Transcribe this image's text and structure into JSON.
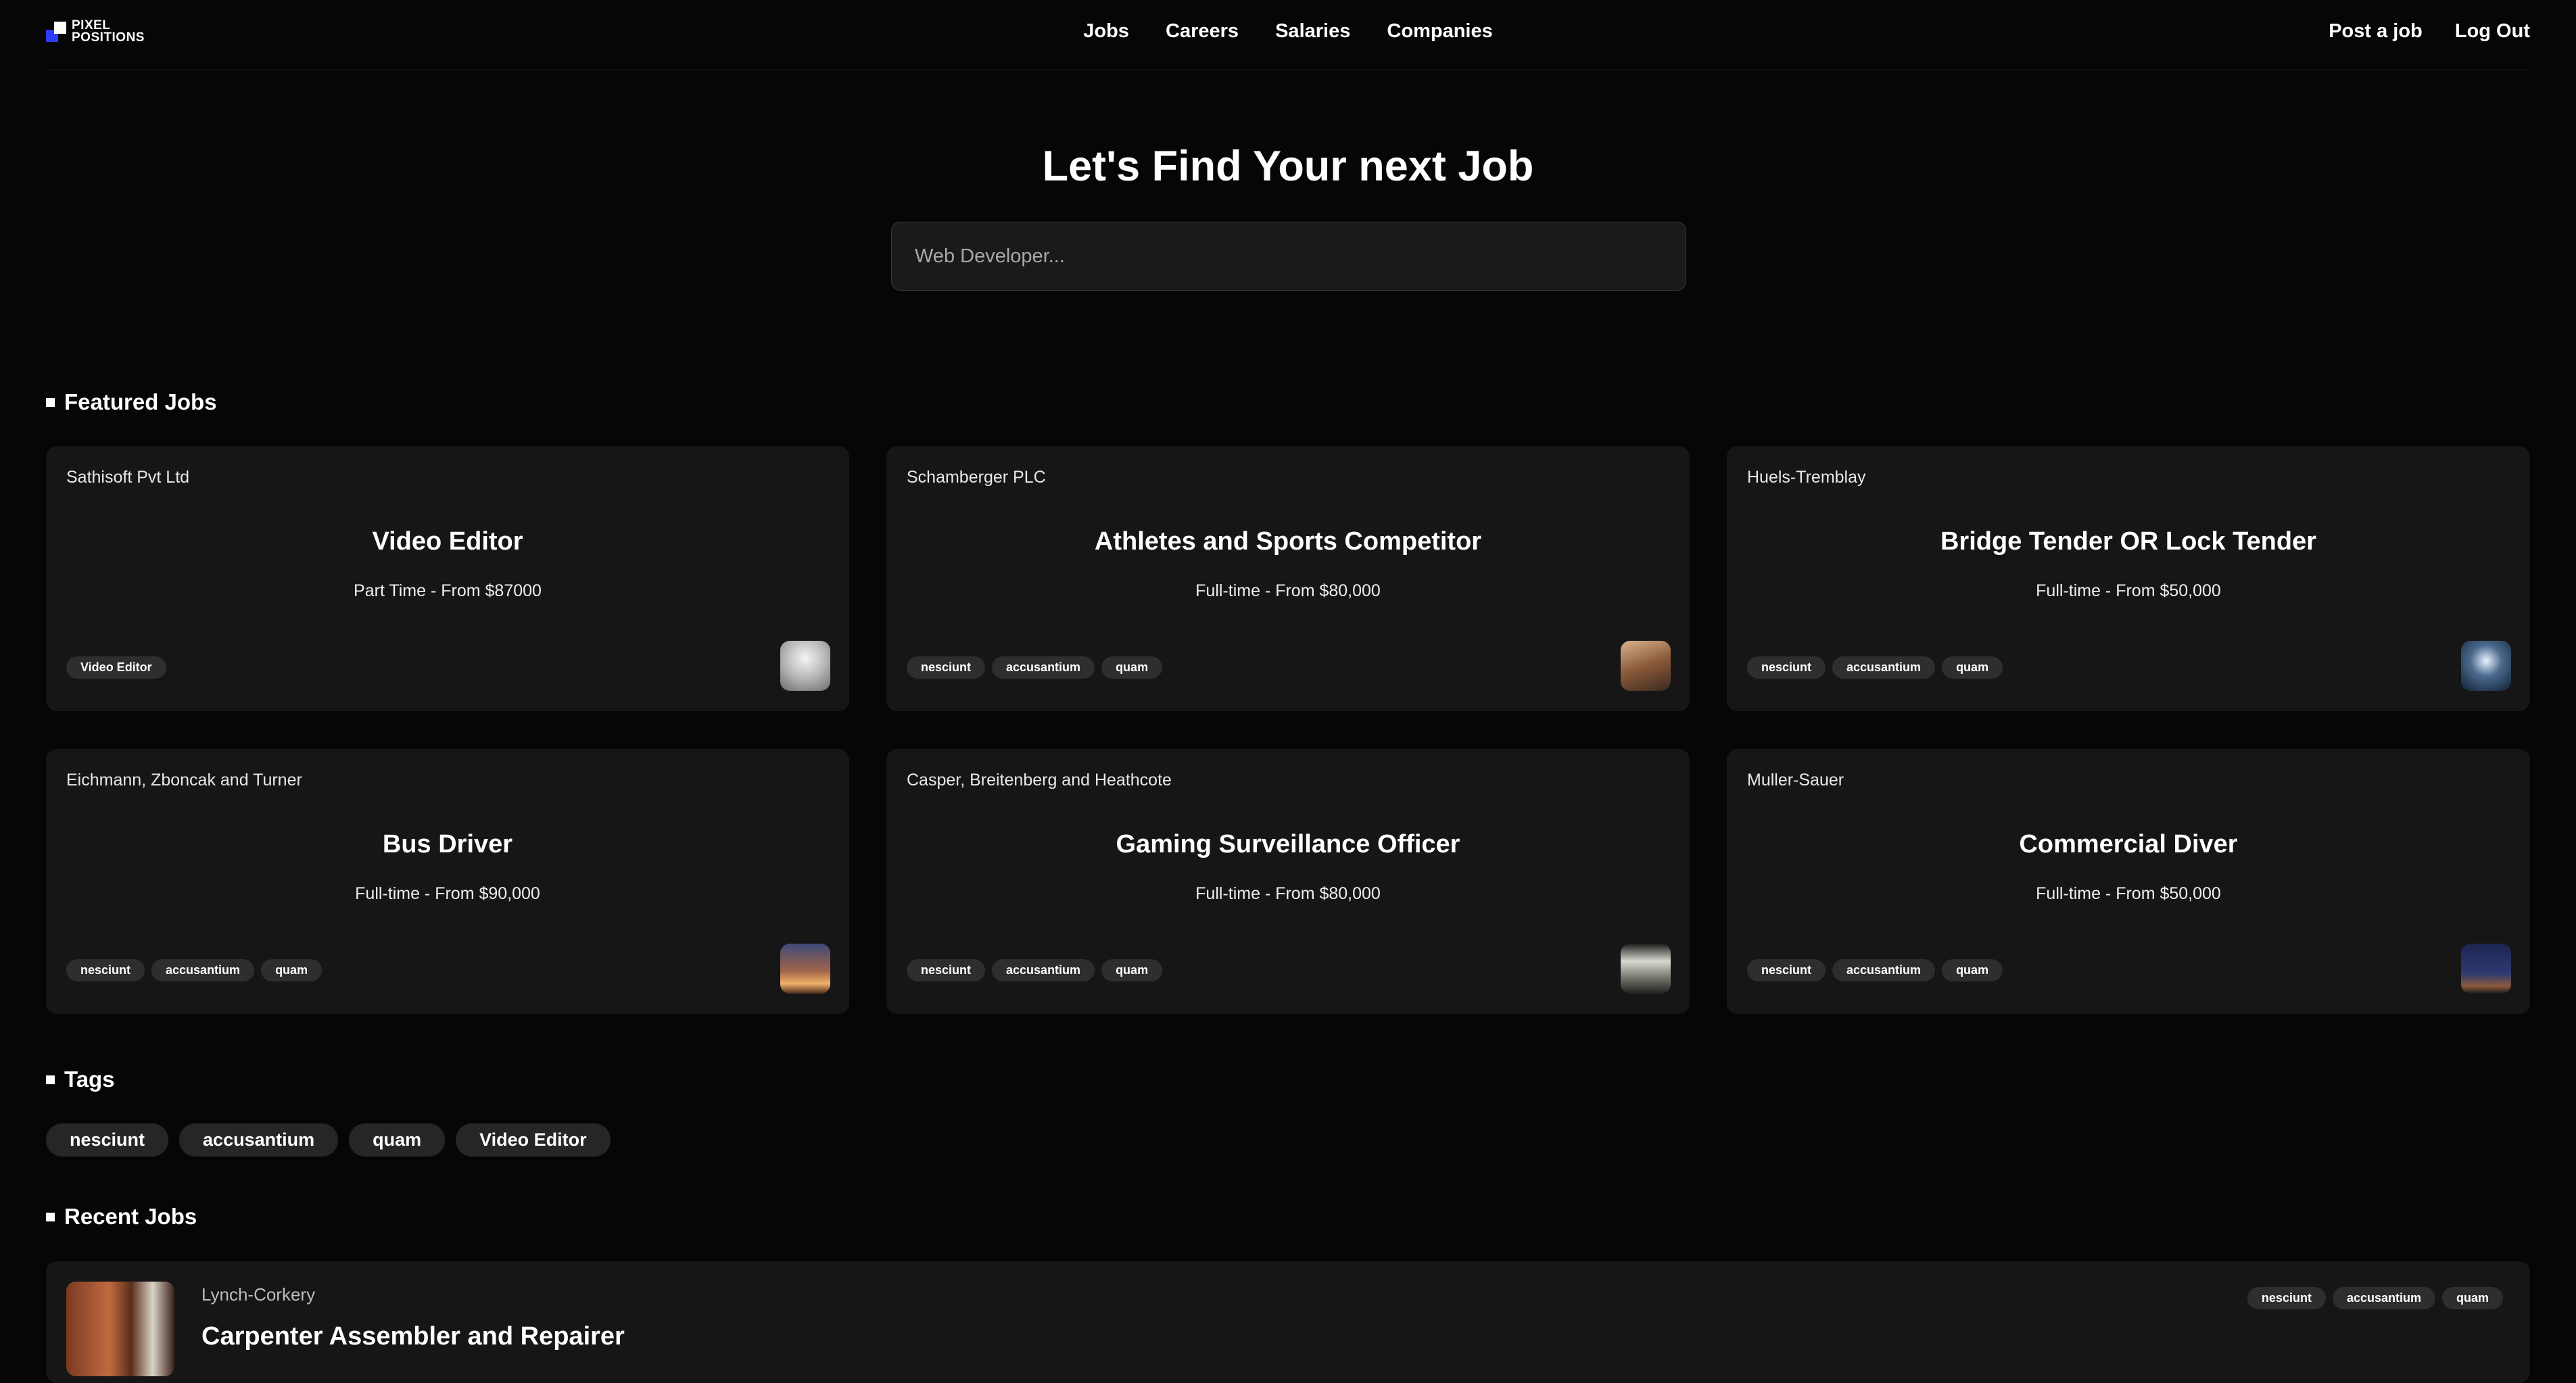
{
  "brand": {
    "logo_line1": "PIXEL",
    "logo_line2": "POSITIONS"
  },
  "nav": [
    "Jobs",
    "Careers",
    "Salaries",
    "Companies"
  ],
  "header_actions": {
    "post_job": "Post a job",
    "logout": "Log Out"
  },
  "hero": {
    "title": "Let's Find Your next Job",
    "search_placeholder": "Web Developer..."
  },
  "featured": {
    "heading": "Featured Jobs",
    "cards": [
      {
        "company": "Sathisoft Pvt Ltd",
        "title": "Video Editor",
        "meta": "Part Time - From $87000",
        "tags": [
          "Video Editor"
        ]
      },
      {
        "company": "Schamberger PLC",
        "title": "Athletes and Sports Competitor",
        "meta": "Full-time - From $80,000",
        "tags": [
          "nesciunt",
          "accusantium",
          "quam"
        ]
      },
      {
        "company": "Huels-Tremblay",
        "title": "Bridge Tender OR Lock Tender",
        "meta": "Full-time - From $50,000",
        "tags": [
          "nesciunt",
          "accusantium",
          "quam"
        ]
      },
      {
        "company": "Eichmann, Zboncak and Turner",
        "title": "Bus Driver",
        "meta": "Full-time - From $90,000",
        "tags": [
          "nesciunt",
          "accusantium",
          "quam"
        ]
      },
      {
        "company": "Casper, Breitenberg and Heathcote",
        "title": "Gaming Surveillance Officer",
        "meta": "Full-time - From $80,000",
        "tags": [
          "nesciunt",
          "accusantium",
          "quam"
        ]
      },
      {
        "company": "Muller-Sauer",
        "title": "Commercial Diver",
        "meta": "Full-time - From $50,000",
        "tags": [
          "nesciunt",
          "accusantium",
          "quam"
        ]
      }
    ]
  },
  "tags_section": {
    "heading": "Tags",
    "tags": [
      "nesciunt",
      "accusantium",
      "quam",
      "Video Editor"
    ]
  },
  "recent": {
    "heading": "Recent Jobs",
    "jobs": [
      {
        "company": "Lynch-Corkery",
        "title": "Carpenter Assembler and Repairer",
        "tags": [
          "nesciunt",
          "accusantium",
          "quam"
        ]
      }
    ]
  }
}
